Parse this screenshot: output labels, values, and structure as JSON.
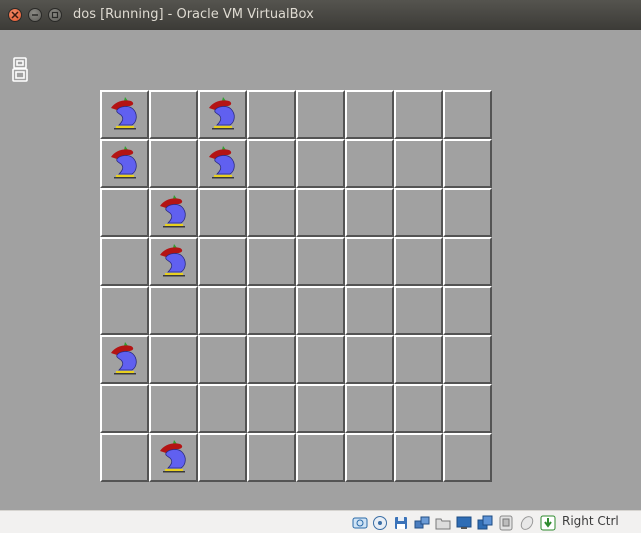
{
  "window": {
    "title": "dos [Running] - Oracle VM VirtualBox"
  },
  "game": {
    "counter": "8",
    "board_size": 8,
    "knights": [
      [
        0,
        0
      ],
      [
        0,
        2
      ],
      [
        1,
        0
      ],
      [
        1,
        2
      ],
      [
        2,
        1
      ],
      [
        3,
        1
      ],
      [
        5,
        0
      ],
      [
        7,
        1
      ]
    ],
    "colors": {
      "background": "#a1a1a1",
      "grid_light": "#ffffff",
      "grid_dark": "#545454",
      "knight_body": "#6060f0",
      "knight_mane": "#b41414"
    }
  },
  "statusbar": {
    "icons": [
      "hard-disk-icon",
      "optical-drive-icon",
      "floppy-icon",
      "network-icon",
      "shared-folders-icon",
      "display-icon",
      "video-capture-icon",
      "usb-icon",
      "mouse-integration-icon",
      "keyboard-capture-icon"
    ],
    "host_key": "Right Ctrl"
  }
}
